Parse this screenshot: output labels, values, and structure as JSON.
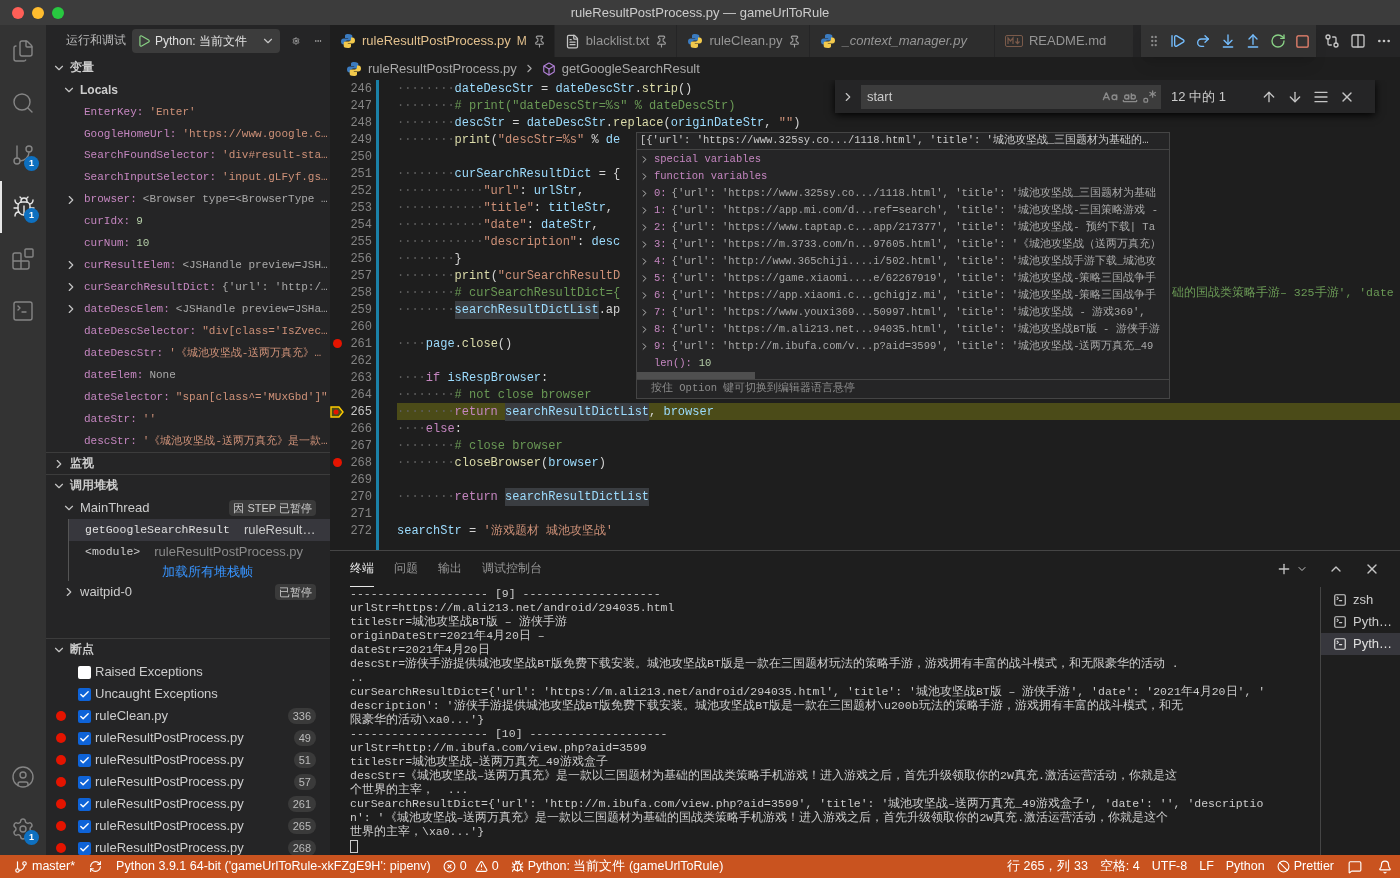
{
  "window": {
    "title": "ruleResultPostProcess.py — gameUrlToRule"
  },
  "activity_bar": {
    "items": [
      {
        "kind": "files",
        "selected": false
      },
      {
        "kind": "search",
        "selected": false
      },
      {
        "kind": "source_control",
        "selected": false,
        "badge": "1"
      },
      {
        "kind": "debug",
        "selected": true,
        "badge": "1"
      },
      {
        "kind": "extensions",
        "selected": false
      },
      {
        "kind": "terminal",
        "selected": false
      }
    ],
    "bottom": [
      {
        "kind": "account"
      },
      {
        "kind": "settings",
        "badge": "1"
      }
    ]
  },
  "sidebar": {
    "title": "运行和调试",
    "config": "Python: 当前文件",
    "variables": {
      "title": "变量",
      "expanded": true,
      "scope": {
        "label": "Locals",
        "expanded": true
      },
      "items": [
        {
          "name": "EnterKey:",
          "value": "'Enter'",
          "kind": "string"
        },
        {
          "name": "GoogleHomeUrl:",
          "value": "'https://www.google.c…",
          "kind": "string"
        },
        {
          "name": "SearchFoundSelector:",
          "value": "'div#result-sta…",
          "kind": "string"
        },
        {
          "name": "SearchInputSelector:",
          "value": "'input.gLFyf.gs…",
          "kind": "string"
        },
        {
          "name": "browser:",
          "value": "<Browser type=<BrowserType …",
          "kind": "object"
        },
        {
          "name": "curIdx:",
          "value": "9",
          "kind": "number"
        },
        {
          "name": "curNum:",
          "value": "10",
          "kind": "number"
        },
        {
          "name": "curResultElem:",
          "value": "<JSHandle preview=JSH…",
          "kind": "object"
        },
        {
          "name": "curSearchResultDict:",
          "value": "{'url': 'http:/…",
          "kind": "object"
        },
        {
          "name": "dateDescElem:",
          "value": "<JSHandle preview=JSHa…",
          "kind": "object"
        },
        {
          "name": "dateDescSelector:",
          "value": "\"div[class='IsZvec…",
          "kind": "string"
        },
        {
          "name": "dateDescStr:",
          "value": "'《城池攻坚战-送两万真充》…",
          "kind": "string"
        },
        {
          "name": "dateElem:",
          "value": "None",
          "kind": "none"
        },
        {
          "name": "dateSelector:",
          "value": "\"span[class^='MUxGbd']\"",
          "kind": "string"
        },
        {
          "name": "dateStr:",
          "value": "''",
          "kind": "string"
        },
        {
          "name": "descStr:",
          "value": "'《城池攻坚战-送两万真充》是一款…",
          "kind": "string"
        }
      ]
    },
    "watch": {
      "title": "监视",
      "expanded": false
    },
    "call_stack": {
      "title": "调用堆栈",
      "expanded": true,
      "threads": [
        {
          "name": "MainThread",
          "expanded": true,
          "status": "因 STEP 已暂停",
          "frames": [
            {
              "name": "getGoogleSearchResult",
              "file": "ruleResult…",
              "selected": true
            },
            {
              "name": "<module>",
              "file": "ruleResultPostProcess.py",
              "selected": false
            }
          ],
          "load_more": "加载所有堆栈帧"
        },
        {
          "name": "waitpid-0",
          "expanded": false,
          "status": "已暂停"
        }
      ]
    },
    "breakpoints": {
      "title": "断点",
      "expanded": true,
      "items": [
        {
          "kind": "exception",
          "label": "Raised Exceptions",
          "checked": false
        },
        {
          "kind": "exception",
          "label": "Uncaught Exceptions",
          "checked": true
        },
        {
          "kind": "file",
          "label": "ruleClean.py",
          "line": "336",
          "checked": true
        },
        {
          "kind": "file",
          "label": "ruleResultPostProcess.py",
          "line": "49",
          "checked": true
        },
        {
          "kind": "file",
          "label": "ruleResultPostProcess.py",
          "line": "51",
          "checked": true
        },
        {
          "kind": "file",
          "label": "ruleResultPostProcess.py",
          "line": "57",
          "checked": true
        },
        {
          "kind": "file",
          "label": "ruleResultPostProcess.py",
          "line": "261",
          "checked": true
        },
        {
          "kind": "file",
          "label": "ruleResultPostProcess.py",
          "line": "265",
          "checked": true
        },
        {
          "kind": "file",
          "label": "ruleResultPostProcess.py",
          "line": "268",
          "checked": true
        }
      ]
    }
  },
  "editor": {
    "tabs": [
      {
        "label": "ruleResultPostProcess.py",
        "status": "M",
        "kind": "python",
        "selected": true,
        "pinned": true,
        "preview": false
      },
      {
        "label": "blacklist.txt",
        "kind": "text",
        "selected": false,
        "pinned": true,
        "preview": false
      },
      {
        "label": "ruleClean.py",
        "kind": "python",
        "selected": false,
        "pinned": true,
        "preview": false
      },
      {
        "label": "_context_manager.py",
        "kind": "python",
        "selected": false,
        "pinned": false,
        "preview": true
      },
      {
        "label": "README.md",
        "kind": "markdown",
        "selected": false,
        "pinned": false,
        "preview": false
      }
    ],
    "breadcrumbs": [
      {
        "label": "ruleResultPostProcess.py",
        "kind": "file"
      },
      {
        "label": "getGoogleSearchResult",
        "kind": "method"
      }
    ],
    "find": {
      "query": "start",
      "result": "12 中的 1"
    },
    "lines": [
      {
        "num": "246",
        "indent": "········",
        "tokens": [
          {
            "t": "dateDescStr",
            "kind": "var"
          },
          {
            "t": " = ",
            "kind": "plain"
          },
          {
            "t": "dateDescStr",
            "kind": "var"
          },
          {
            "t": ".",
            "kind": "plain"
          },
          {
            "t": "strip",
            "kind": "func"
          },
          {
            "t": "()",
            "kind": "plain"
          }
        ]
      },
      {
        "num": "247",
        "indent": "········",
        "tokens": [
          {
            "t": "# print(\"dateDescStr=%s\" % dateDescStr)",
            "kind": "comment"
          }
        ]
      },
      {
        "num": "248",
        "indent": "········",
        "tokens": [
          {
            "t": "descStr",
            "kind": "var"
          },
          {
            "t": " = ",
            "kind": "plain"
          },
          {
            "t": "dateDescStr",
            "kind": "var"
          },
          {
            "t": ".",
            "kind": "plain"
          },
          {
            "t": "replace",
            "kind": "func"
          },
          {
            "t": "(",
            "kind": "plain"
          },
          {
            "t": "originDateStr",
            "kind": "var"
          },
          {
            "t": ", ",
            "kind": "plain"
          },
          {
            "t": "\"\"",
            "kind": "string"
          },
          {
            "t": ")",
            "kind": "plain"
          }
        ]
      },
      {
        "num": "249",
        "indent": "········",
        "tokens": [
          {
            "t": "print",
            "kind": "func"
          },
          {
            "t": "(",
            "kind": "plain"
          },
          {
            "t": "\"descStr=%s\"",
            "kind": "string"
          },
          {
            "t": " % ",
            "kind": "plain"
          },
          {
            "t": "de",
            "kind": "var"
          }
        ]
      },
      {
        "num": "250"
      },
      {
        "num": "251",
        "indent": "········",
        "tokens": [
          {
            "t": "curSearchResultDict",
            "kind": "var"
          },
          {
            "t": " = {",
            "kind": "plain"
          }
        ]
      },
      {
        "num": "252",
        "indent": "············",
        "tokens": [
          {
            "t": "\"url\"",
            "kind": "string"
          },
          {
            "t": ": ",
            "kind": "plain"
          },
          {
            "t": "urlStr",
            "kind": "var"
          },
          {
            "t": ",",
            "kind": "plain"
          }
        ]
      },
      {
        "num": "253",
        "indent": "············",
        "tokens": [
          {
            "t": "\"title\"",
            "kind": "string"
          },
          {
            "t": ": ",
            "kind": "plain"
          },
          {
            "t": "titleStr",
            "kind": "var"
          },
          {
            "t": ",",
            "kind": "plain"
          }
        ]
      },
      {
        "num": "254",
        "indent": "············",
        "tokens": [
          {
            "t": "\"date\"",
            "kind": "string"
          },
          {
            "t": ": ",
            "kind": "plain"
          },
          {
            "t": "dateStr",
            "kind": "var"
          },
          {
            "t": ",",
            "kind": "plain"
          }
        ]
      },
      {
        "num": "255",
        "indent": "············",
        "tokens": [
          {
            "t": "\"description\"",
            "kind": "string"
          },
          {
            "t": ": ",
            "kind": "plain"
          },
          {
            "t": "desc",
            "kind": "var"
          }
        ]
      },
      {
        "num": "256",
        "indent": "········",
        "tokens": [
          {
            "t": "}",
            "kind": "plain"
          }
        ]
      },
      {
        "num": "257",
        "indent": "········",
        "tokens": [
          {
            "t": "print",
            "kind": "func"
          },
          {
            "t": "(",
            "kind": "plain"
          },
          {
            "t": "\"curSearchResultD",
            "kind": "string"
          }
        ]
      },
      {
        "num": "258",
        "indent": "········",
        "tokens": [
          {
            "t": "# curSearchResultDict={",
            "kind": "comment"
          }
        ],
        "tail": "础的国战类策略手游– 325手游', 'date"
      },
      {
        "num": "259",
        "indent": "········",
        "tokens": [
          {
            "t": "searchResultDictList",
            "kind": "match"
          },
          {
            "t": ".ap",
            "kind": "plain"
          }
        ]
      },
      {
        "num": "260"
      },
      {
        "num": "261",
        "indent": "····",
        "breakpoint": true,
        "tokens": [
          {
            "t": "page",
            "kind": "var"
          },
          {
            "t": ".",
            "kind": "plain"
          },
          {
            "t": "close",
            "kind": "func"
          },
          {
            "t": "()",
            "kind": "plain"
          }
        ]
      },
      {
        "num": "262"
      },
      {
        "num": "263",
        "indent": "····",
        "tokens": [
          {
            "t": "if ",
            "kind": "keyword"
          },
          {
            "t": "isRespBrowser",
            "kind": "var"
          },
          {
            "t": ":",
            "kind": "plain"
          }
        ]
      },
      {
        "num": "264",
        "indent": "········",
        "tokens": [
          {
            "t": "# not close browser",
            "kind": "comment"
          }
        ]
      },
      {
        "num": "265",
        "indent": "········",
        "breakpoint": true,
        "current": true,
        "tokens": [
          {
            "t": "return ",
            "kind": "keyword"
          },
          {
            "t": "searchResultDictList",
            "kind": "match"
          },
          {
            "t": ", ",
            "kind": "plain"
          },
          {
            "t": "browser",
            "kind": "var"
          }
        ]
      },
      {
        "num": "266",
        "indent": "····",
        "tokens": [
          {
            "t": "else",
            "kind": "keyword"
          },
          {
            "t": ":",
            "kind": "plain"
          }
        ]
      },
      {
        "num": "267",
        "indent": "········",
        "tokens": [
          {
            "t": "# close browser",
            "kind": "comment"
          }
        ]
      },
      {
        "num": "268",
        "indent": "········",
        "breakpoint": true,
        "tokens": [
          {
            "t": "closeBrowser",
            "kind": "func"
          },
          {
            "t": "(",
            "kind": "plain"
          },
          {
            "t": "browser",
            "kind": "var"
          },
          {
            "t": ")",
            "kind": "plain"
          }
        ]
      },
      {
        "num": "269"
      },
      {
        "num": "270",
        "indent": "········",
        "tokens": [
          {
            "t": "return ",
            "kind": "keyword"
          },
          {
            "t": "searchResultDictList",
            "kind": "match"
          }
        ]
      },
      {
        "num": "271"
      },
      {
        "num": "272",
        "tokens": [
          {
            "t": "searchStr",
            "kind": "var"
          },
          {
            "t": " = ",
            "kind": "plain"
          },
          {
            "t": "'游戏题材 城池攻坚战'",
            "kind": "string"
          }
        ]
      }
    ],
    "hover": {
      "header": "[{'url': 'https://www.325sy.co.../1118.html', 'title': '城池攻坚战_三国题材为基础的…",
      "rows": [
        {
          "kind": "group",
          "label": "special variables"
        },
        {
          "kind": "group",
          "label": "function variables"
        },
        {
          "kind": "item",
          "label": "0:",
          "value": "{'url': 'https://www.325sy.co.../1118.html', 'title': '城池攻坚战_三国题材为基础"
        },
        {
          "kind": "item",
          "label": "1:",
          "value": "{'url': 'https://app.mi.com/d...ref=search', 'title': '城池攻坚战-三国策略游戏 -"
        },
        {
          "kind": "item",
          "label": "2:",
          "value": "{'url': 'https://www.taptap.c...app/217377', 'title': '城池攻坚战- 预约下载| Ta"
        },
        {
          "kind": "item",
          "label": "3:",
          "value": "{'url': 'https://m.3733.com/n...97605.html', 'title': '《城池攻坚战（送两万真充）"
        },
        {
          "kind": "item",
          "label": "4:",
          "value": "{'url': 'http://www.365chiji....i/502.html', 'title': '城池攻坚战手游下载_城池攻"
        },
        {
          "kind": "item",
          "label": "5:",
          "value": "{'url': 'https://game.xiaomi....e/62267919', 'title': '城池攻坚战-策略三国战争手"
        },
        {
          "kind": "item",
          "label": "6:",
          "value": "{'url': 'https://app.xiaomi.c...gchigjz.mi', 'title': '城池攻坚战-策略三国战争手"
        },
        {
          "kind": "item",
          "label": "7:",
          "value": "{'url': 'https://www.youxi369...50997.html', 'title': '城池攻坚战 - 游戏369',"
        },
        {
          "kind": "item",
          "label": "8:",
          "value": "{'url': 'https://m.ali213.net...94035.html', 'title': '城池攻坚战BT版 - 游侠手游"
        },
        {
          "kind": "item",
          "label": "9:",
          "value": "{'url': 'http://m.ibufa.com/v...p?aid=3599', 'title': '城池攻坚战-送两万真充_49"
        },
        {
          "kind": "len",
          "label": "len():",
          "value": "10"
        }
      ],
      "footer": "按住 Option 键可切换到编辑器语言悬停"
    }
  },
  "panel": {
    "tabs": [
      {
        "label": "终端",
        "selected": true
      },
      {
        "label": "问题",
        "selected": false
      },
      {
        "label": "输出",
        "selected": false
      },
      {
        "label": "调试控制台",
        "selected": false
      }
    ],
    "terminal": [
      "-------------------- [9] --------------------",
      "urlStr=https://m.ali213.net/android/294035.html",
      "titleStr=城池攻坚战BT版 – 游侠手游",
      "originDateStr=2021年4月20日 –",
      "dateStr=2021年4月20日",
      "descStr=游侠手游提供城池攻坚战BT版免费下载安装。城池攻坚战BT版是一款在三国题材玩法的策略手游，游戏拥有丰富的战斗模式，和无限豪华的活动 .",
      "..",
      "curSearchResultDict={'url': 'https://m.ali213.net/android/294035.html', 'title': '城池攻坚战BT版 – 游侠手游', 'date': '2021年4月20日', '",
      "description': '游侠手游提供城池攻坚战BT版免费下载安装。城池攻坚战BT版是一款在三国题材\\u200b玩法的策略手游，游戏拥有丰富的战斗模式，和无",
      "限豪华的活动\\xa0...'}",
      "-------------------- [10] --------------------",
      "urlStr=http://m.ibufa.com/view.php?aid=3599",
      "titleStr=城池攻坚战–送两万真充_49游戏盒子",
      "descStr=《城池攻坚战–送两万真充》是一款以三国题材为基础的国战类策略手机游戏！进入游戏之后，首先升级领取你的2W真充.激活运营活动，你就是这",
      "个世界的主宰，  ...",
      "curSearchResultDict={'url': 'http://m.ibufa.com/view.php?aid=3599', 'title': '城池攻坚战–送两万真充_49游戏盒子', 'date': '', 'descriptio",
      "n': '《城池攻坚战–送两万真充》是一款以三国题材为基础的国战类策略手机游戏！进入游戏之后，首先升级领取你的2W真充.激活运营活动，你就是这个",
      "世界的主宰，\\xa0...'}"
    ],
    "sessions": [
      {
        "label": "zsh",
        "selected": false
      },
      {
        "label": "Pyth…",
        "selected": false
      },
      {
        "label": "Pyth…",
        "selected": true
      }
    ]
  },
  "status_bar": {
    "branch": "master*",
    "interpreter": "Python 3.9.1 64-bit ('gameUrlToRule-xkFZgE9H': pipenv)",
    "errors": "0",
    "warnings": "0",
    "launch": "Python: 当前文件 (gameUrlToRule)",
    "position": "行 265，列 33",
    "indent": "空格: 4",
    "encoding": "UTF-8",
    "eol": "LF",
    "language": "Python",
    "formatter": "Prettier"
  }
}
